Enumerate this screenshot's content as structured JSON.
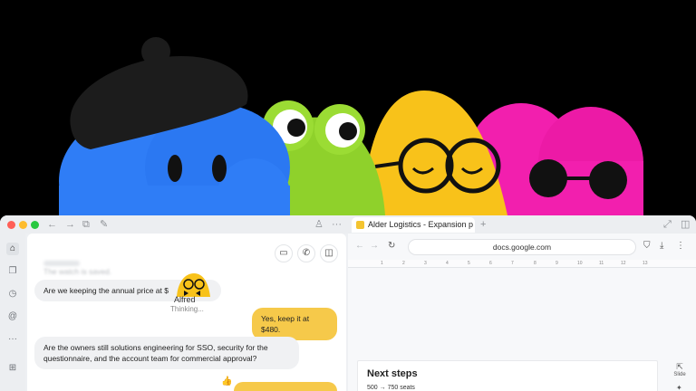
{
  "chat": {
    "faded_line": "The watch is saved.",
    "msg1": "Are we keeping the annual price at $",
    "msg1_tail": "?",
    "reply1": "Yes, keep it at $480.",
    "msg2_line1": "Are the owners still solutions engineering for SSO, security for the",
    "msg2_line2": "questionnaire, and the account team for commercial approval?",
    "assistant_name": "Alfred",
    "assistant_status": "Thinking..."
  },
  "docs": {
    "tab_title": "Alder Logistics - Expansion p",
    "address": "docs.google.com",
    "ruler_ticks": [
      "1",
      "2",
      "3",
      "4",
      "5",
      "6",
      "7",
      "8",
      "9",
      "10",
      "11",
      "12",
      "13"
    ],
    "heading": "Next steps",
    "subtext": "500 → 750 seats",
    "slide_label": "Slide"
  },
  "colors": {
    "accent": "#f6c94a",
    "blue_plush": "#2f7df6",
    "green_plush": "#8fd12b",
    "yellow_plush": "#f8c21a",
    "pink_plush": "#f21fae"
  }
}
